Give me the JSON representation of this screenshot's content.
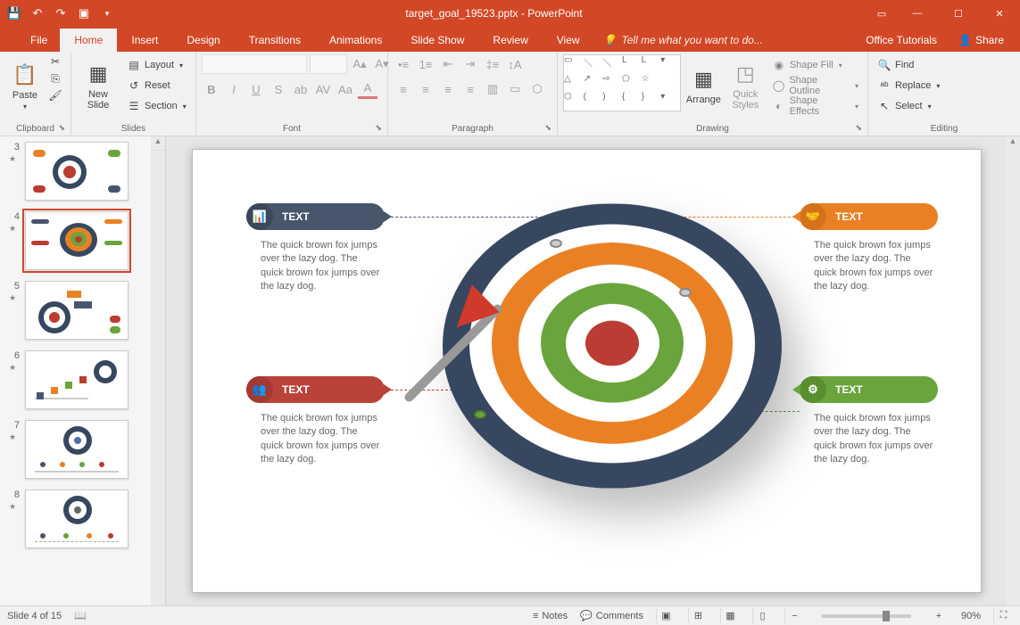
{
  "titlebar": {
    "doc_title": "target_goal_19523.pptx - PowerPoint"
  },
  "tabs": {
    "file": "File",
    "home": "Home",
    "insert": "Insert",
    "design": "Design",
    "transitions": "Transitions",
    "animations": "Animations",
    "slideshow": "Slide Show",
    "review": "Review",
    "view": "View",
    "tellme": "Tell me what you want to do...",
    "tutorials": "Office Tutorials",
    "share": "Share"
  },
  "ribbon": {
    "clipboard": {
      "label": "Clipboard",
      "paste": "Paste"
    },
    "slides": {
      "label": "Slides",
      "new_slide": "New\nSlide",
      "layout": "Layout",
      "reset": "Reset",
      "section": "Section"
    },
    "font": {
      "label": "Font"
    },
    "paragraph": {
      "label": "Paragraph"
    },
    "drawing": {
      "label": "Drawing",
      "arrange": "Arrange",
      "quick_styles": "Quick\nStyles",
      "shape_fill": "Shape Fill",
      "shape_outline": "Shape Outline",
      "shape_effects": "Shape Effects"
    },
    "editing": {
      "label": "Editing",
      "find": "Find",
      "replace": "Replace",
      "select": "Select"
    }
  },
  "thumbs": [
    {
      "n": "3"
    },
    {
      "n": "4"
    },
    {
      "n": "5"
    },
    {
      "n": "6"
    },
    {
      "n": "7"
    },
    {
      "n": "8"
    }
  ],
  "slide": {
    "callouts": [
      {
        "title": "TEXT",
        "body": "The quick brown fox jumps over the lazy dog. The quick brown fox jumps over the lazy dog."
      },
      {
        "title": "TEXT",
        "body": "The quick brown fox jumps over the lazy dog. The quick brown fox jumps over the lazy dog."
      },
      {
        "title": "TEXT",
        "body": "The quick brown fox jumps over the lazy dog. The quick brown fox jumps over the lazy dog."
      },
      {
        "title": "TEXT",
        "body": "The quick brown fox jumps over the lazy dog. The quick brown fox jumps over the lazy dog."
      }
    ]
  },
  "status": {
    "slide_counter": "Slide 4 of 15",
    "notes": "Notes",
    "comments": "Comments",
    "zoom": "90%"
  }
}
